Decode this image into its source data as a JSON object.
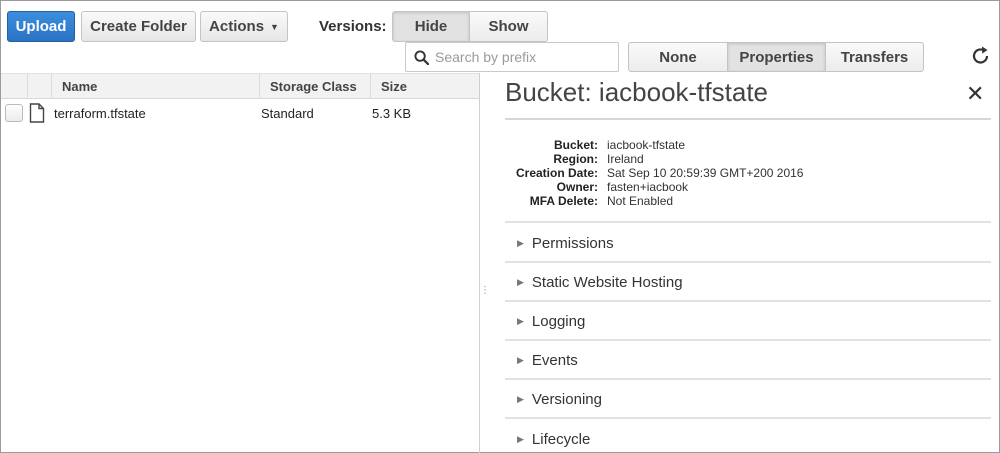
{
  "toolbar": {
    "upload_label": "Upload",
    "create_folder_label": "Create Folder",
    "actions_label": "Actions",
    "versions_label": "Versions:",
    "hide_label": "Hide",
    "show_label": "Show"
  },
  "search": {
    "placeholder": "Search by prefix"
  },
  "view_tabs": {
    "none": "None",
    "properties": "Properties",
    "transfers": "Transfers"
  },
  "table": {
    "headers": {
      "name": "Name",
      "storage_class": "Storage Class",
      "size": "Size"
    },
    "rows": [
      {
        "name": "terraform.tfstate",
        "storage_class": "Standard",
        "size": "5.3 KB"
      }
    ]
  },
  "panel": {
    "title": "Bucket: iacbook-tfstate",
    "close_symbol": "✕",
    "info": {
      "bucket_key": "Bucket:",
      "bucket_val": "iacbook-tfstate",
      "region_key": "Region:",
      "region_val": "Ireland",
      "creation_key": "Creation Date:",
      "creation_val": "Sat Sep 10 20:59:39 GMT+200 2016",
      "owner_key": "Owner:",
      "owner_val": "fasten+iacbook",
      "mfa_key": "MFA Delete:",
      "mfa_val": "Not Enabled"
    },
    "sections": [
      "Permissions",
      "Static Website Hosting",
      "Logging",
      "Events",
      "Versioning",
      "Lifecycle"
    ]
  },
  "colors": {
    "primary": "#2a72c4",
    "border": "#c4c4c4"
  }
}
